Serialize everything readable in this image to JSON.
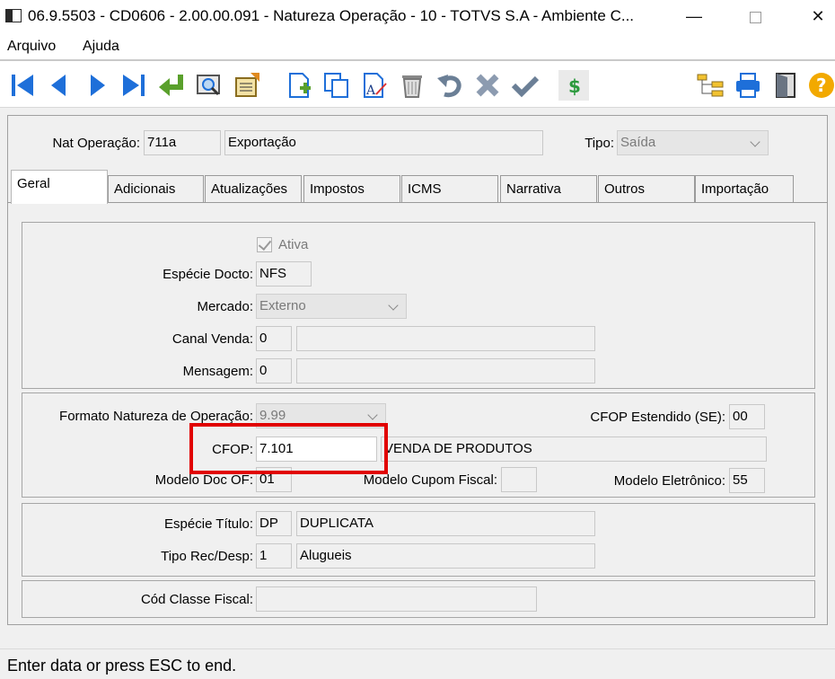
{
  "window": {
    "title": "06.9.5503 - CD0606 - 2.00.00.091 - Natureza Operação - 10 - TOTVS S.A - Ambiente C...",
    "minimize": "—",
    "close": "✕"
  },
  "menu": {
    "items": [
      "Arquivo",
      "Ajuda"
    ]
  },
  "toolbar": {
    "buttons": [
      "first-record-icon",
      "previous-record-icon",
      "next-record-icon",
      "last-record-icon",
      "go-to-icon",
      "search-icon",
      "list-icon",
      "new-icon",
      "copy-icon",
      "edit-icon",
      "delete-icon",
      "undo-icon",
      "cancel-icon",
      "save-icon",
      "dollar-icon",
      "tree-icon",
      "print-icon",
      "exit-icon",
      "help-icon"
    ],
    "dollar_symbol": "$",
    "help_symbol": "?"
  },
  "header": {
    "nat_label": "Nat Operação:",
    "nat_code": "711a",
    "nat_desc": "Exportação",
    "tipo_label": "Tipo:",
    "tipo_value": "Saída"
  },
  "tabs": [
    "Geral",
    "Adicionais",
    "Atualizações",
    "Impostos",
    "ICMS",
    "Narrativa",
    "Outros",
    "Importação"
  ],
  "geral": {
    "ativa_label": "Ativa",
    "especie_label": "Espécie Docto:",
    "especie_value": "NFS",
    "mercado_label": "Mercado:",
    "mercado_value": "Externo",
    "canal_label": "Canal Venda:",
    "canal_value": "0",
    "canal_desc": "",
    "mensagem_label": "Mensagem:",
    "mensagem_value": "0",
    "mensagem_desc": "",
    "formato_label": "Formato Natureza de Operação:",
    "formato_value": "9.99",
    "cfop_ext_label": "CFOP Estendido (SE):",
    "cfop_ext_value": "00",
    "cfop_label": "CFOP:",
    "cfop_value": "7.101",
    "cfop_desc": "VENDA DE PRODUTOS",
    "modelo_doc_label": "Modelo Doc OF:",
    "modelo_doc_value": "01",
    "modelo_cupom_label": "Modelo Cupom Fiscal:",
    "modelo_cupom_value": "",
    "modelo_elet_label": "Modelo Eletrônico:",
    "modelo_elet_value": "55",
    "especie_titulo_label": "Espécie Título:",
    "especie_titulo_value": "DP",
    "especie_titulo_desc": "DUPLICATA",
    "tipo_rec_label": "Tipo Rec/Desp:",
    "tipo_rec_value": "1",
    "tipo_rec_desc": "Alugueis",
    "cod_classe_label": "Cód Classe Fiscal:",
    "cod_classe_value": ""
  },
  "status": {
    "text": "Enter data or press ESC to end."
  },
  "colors": {
    "highlight": "#e10000",
    "toolbar_blue": "#1e6fd9",
    "toolbar_green": "#5aa02c"
  }
}
